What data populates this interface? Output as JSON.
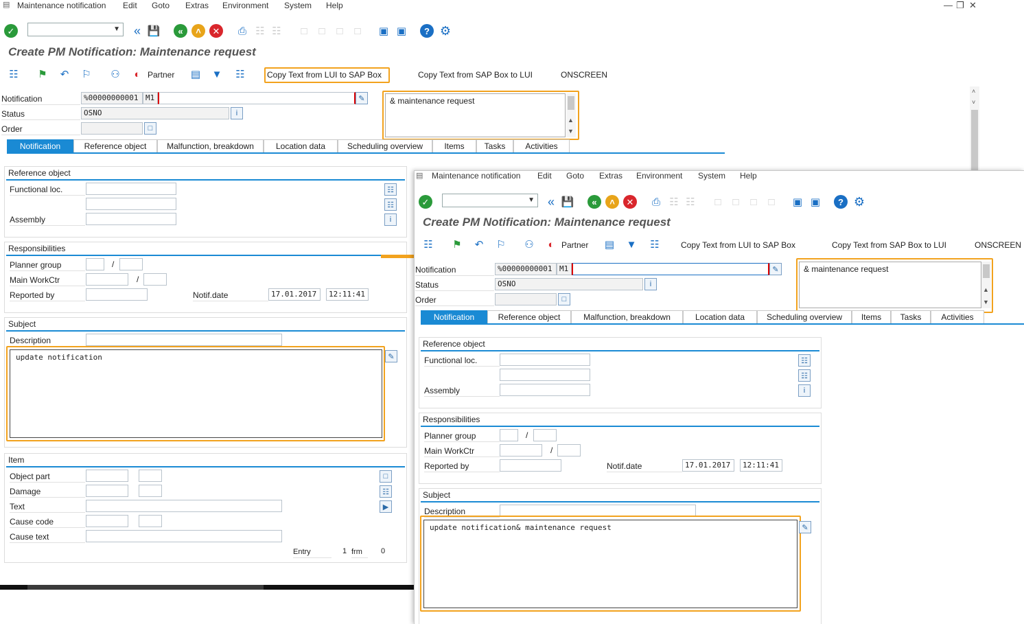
{
  "menu": {
    "items": [
      "Maintenance notification",
      "Edit",
      "Goto",
      "Extras",
      "Environment",
      "System",
      "Help"
    ]
  },
  "title": "Create PM Notification: Maintenance request",
  "toolbar": {
    "partner": "Partner",
    "copy_lui_to_sap": "Copy Text from LUI to SAP Box",
    "copy_sap_to_lui": "Copy Text from SAP Box to LUI",
    "onscreen": "ONSCREEN"
  },
  "header": {
    "notification_label": "Notification",
    "notification_value": "%00000000001",
    "notification_type": "M1",
    "status_label": "Status",
    "status_value": "OSNO",
    "order_label": "Order",
    "memo_text": "& maintenance request"
  },
  "tabs": [
    "Notification",
    "Reference object",
    "Malfunction, breakdown",
    "Location data",
    "Scheduling overview",
    "Items",
    "Tasks",
    "Activities"
  ],
  "reference_object": {
    "heading": "Reference object",
    "functional_loc": "Functional loc.",
    "assembly": "Assembly"
  },
  "responsibilities": {
    "heading": "Responsibilities",
    "planner_group": "Planner group",
    "main_workctr": "Main WorkCtr",
    "reported_by": "Reported by",
    "notif_date_label": "Notif.date",
    "notif_date": "17.01.2017",
    "notif_time": "12:11:41",
    "slash": "/"
  },
  "subject": {
    "heading": "Subject",
    "description": "Description",
    "text_before": "update notification",
    "text_after": "update notification& maintenance request"
  },
  "item": {
    "heading": "Item",
    "object_part": "Object part",
    "damage": "Damage",
    "text": "Text",
    "cause_code": "Cause code",
    "cause_text": "Cause text",
    "entry_label": "Entry",
    "entry_value": "1",
    "entry_of": "frm",
    "entry_total": "0"
  },
  "colors": {
    "accent": "#1a8ad4",
    "highlight": "#f2a21d",
    "ok": "#2a9a3a",
    "cancel": "#d9262c",
    "exit": "#e8a41a"
  }
}
